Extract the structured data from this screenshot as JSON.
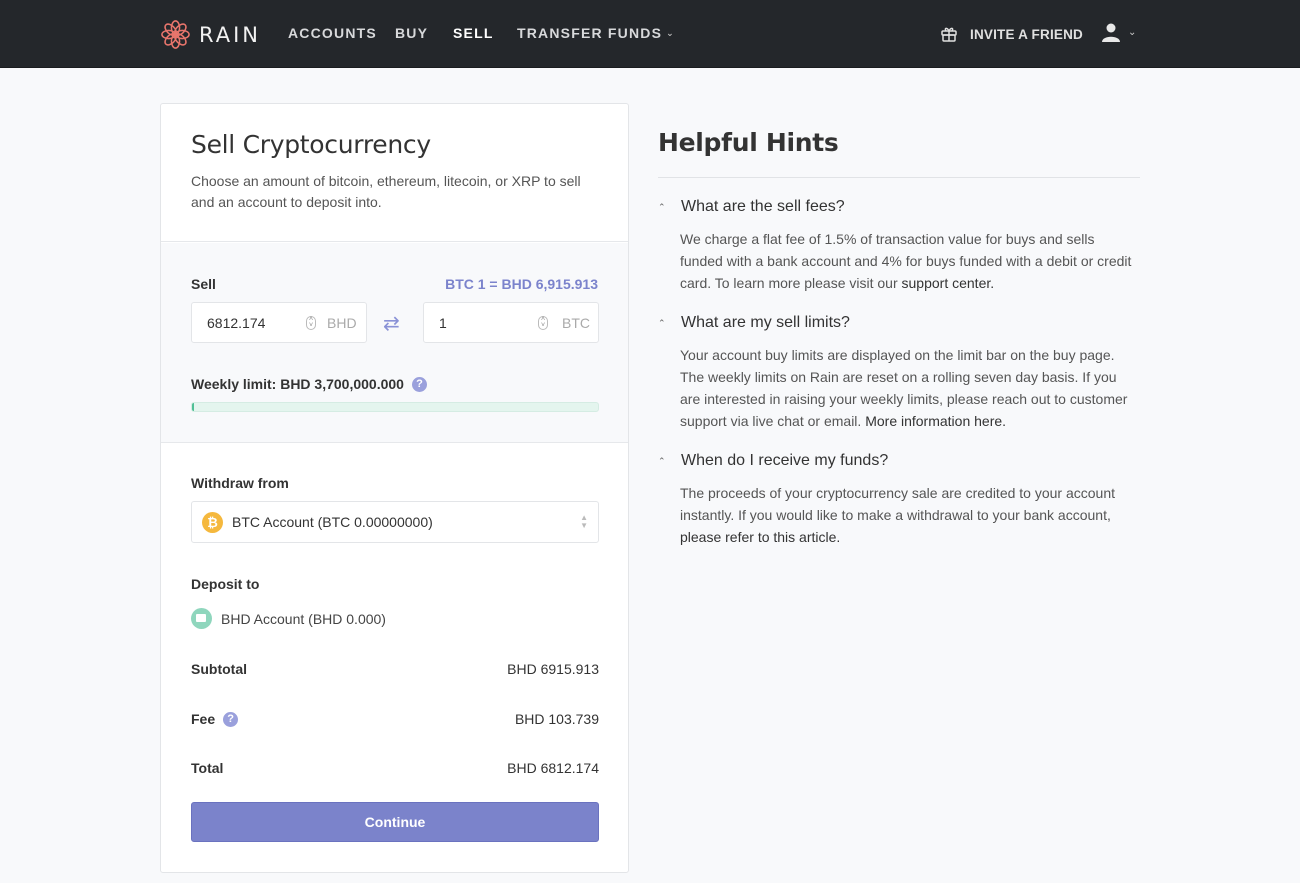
{
  "nav": {
    "brand": "RAIN",
    "items": [
      {
        "label": "ACCOUNTS",
        "active": false
      },
      {
        "label": "BUY",
        "active": false
      },
      {
        "label": "SELL",
        "active": true
      },
      {
        "label": "TRANSFER FUNDS",
        "active": false,
        "dropdown": true
      }
    ],
    "invite_label": "INVITE A FRIEND",
    "icons": {
      "gift": "gift-icon",
      "user": "user-icon",
      "chevron": "chevron-down-icon"
    }
  },
  "colors": {
    "accent": "#7b83cb",
    "rate_text": "#7b83cc",
    "limit_bar": "#4fbf95",
    "btc": "#f5b83d",
    "bhd": "#8fd6bd",
    "logo": "#e8756c",
    "navbar": "#24272b"
  },
  "sell_card": {
    "title": "Sell Cryptocurrency",
    "description": "Choose an amount of bitcoin, ethereum, litecoin, or XRP to sell and an account to deposit into.",
    "sell_label": "Sell",
    "rate": "BTC 1 = BHD 6,915.913",
    "fiat_amount": "6812.174",
    "fiat_currency": "BHD",
    "crypto_amount": "1",
    "crypto_currency": "BTC",
    "weekly_limit_label": "Weekly limit: BHD 3,700,000.000",
    "weekly_limit_used_fraction": 0.002,
    "withdraw_label": "Withdraw from",
    "withdraw_account": "BTC Account  (BTC 0.00000000)",
    "btc_symbol": "₿",
    "deposit_label": "Deposit to",
    "deposit_account": "BHD Account  (BHD 0.000)",
    "subtotal_label": "Subtotal",
    "subtotal_value": "BHD 6915.913",
    "fee_label": "Fee",
    "fee_value": "BHD 103.739",
    "total_label": "Total",
    "total_value": "BHD 6812.174",
    "continue_label": "Continue",
    "help_glyph": "?"
  },
  "hints": {
    "title": "Helpful Hints",
    "items": [
      {
        "question": "What are the sell fees?",
        "answer": "We charge a flat fee of 1.5% of transaction value for buys and sells funded with a bank account and 4% for buys funded with a debit or credit card. To learn more please visit our ",
        "link": "support center."
      },
      {
        "question": "What are my sell limits?",
        "answer": "Your account buy limits are displayed on the limit bar on the buy page. The weekly limits on Rain are reset on a rolling seven day basis. If you are interested in raising your weekly limits, please reach out to customer support via live chat or email. ",
        "link": "More information here."
      },
      {
        "question": "When do I receive my funds?",
        "answer": "The proceeds of your cryptocurrency sale are credited to your account instantly. If you would like to make a withdrawal to your bank account, ",
        "link": "please refer to this article."
      }
    ]
  }
}
